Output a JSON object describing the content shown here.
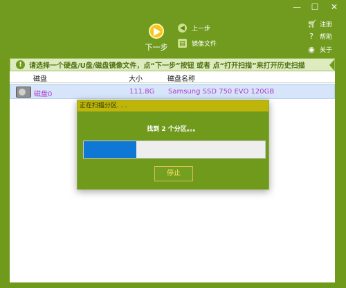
{
  "window": {
    "minimize_glyph": "—",
    "maximize_glyph": "☐",
    "close_glyph": "✕"
  },
  "toolbar": {
    "next_label": "下一步",
    "prev_label": "上一步",
    "image_label": "镜像文件",
    "register_label": "注册",
    "help_label": "帮助",
    "about_label": "关于"
  },
  "notice": {
    "icon_glyph": "!",
    "text": "请选择一个硬盘/U盘/磁盘镜像文件，点“下一步”按钮 或者 点“打开扫描”来打开历史扫描"
  },
  "table": {
    "headers": [
      "磁盘",
      "大小",
      "磁盘名称"
    ],
    "rows": [
      {
        "disk": "磁盘0",
        "size": "111.8G",
        "name": "Samsung SSD 750 EVO 120GB"
      }
    ]
  },
  "dialog": {
    "title": "正在扫描分区. . .",
    "message": "找到 2 个分区。。。",
    "progress_fraction": 0.29,
    "stop_label": "停止"
  },
  "colors": {
    "theme_green": "#6f9a1c",
    "dialog_title_bar": "#bfb40a",
    "progress_fill": "#0f78d7",
    "disk_text": "#b03ad0"
  }
}
